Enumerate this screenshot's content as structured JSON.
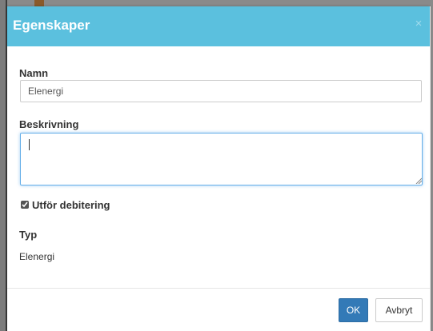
{
  "dialog": {
    "title": "Egenskaper",
    "close_symbol": "×"
  },
  "form": {
    "name_label": "Namn",
    "name_value": "Elenergi",
    "description_label": "Beskrivning",
    "description_value": "",
    "billing_label": "Utför debitering",
    "billing_checked": true,
    "type_label": "Typ",
    "type_value": "Elenergi"
  },
  "footer": {
    "ok_label": "OK",
    "cancel_label": "Avbryt"
  },
  "colors": {
    "header": "#5bc0de",
    "primary": "#337ab7",
    "focus": "#66afe9"
  }
}
